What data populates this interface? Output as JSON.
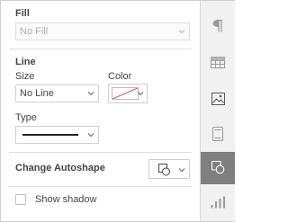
{
  "fill": {
    "title": "Fill",
    "value": "No Fill"
  },
  "line": {
    "title": "Line",
    "size_label": "Size",
    "size_value": "No Line",
    "color_label": "Color",
    "type_label": "Type"
  },
  "autoshape": {
    "label": "Change Autoshape"
  },
  "shadow": {
    "label": "Show shadow",
    "checked": false
  },
  "sidebar": {
    "items": [
      {
        "icon": "paragraph-icon",
        "active": false
      },
      {
        "icon": "table-icon",
        "active": false
      },
      {
        "icon": "image-icon",
        "active": false
      },
      {
        "icon": "slide-icon",
        "active": false
      },
      {
        "icon": "shape-icon",
        "active": true
      },
      {
        "icon": "chart-icon",
        "active": false
      }
    ]
  },
  "colors": {
    "accent_active": "#7f7f7f",
    "no_color_slash": "#e04040"
  }
}
